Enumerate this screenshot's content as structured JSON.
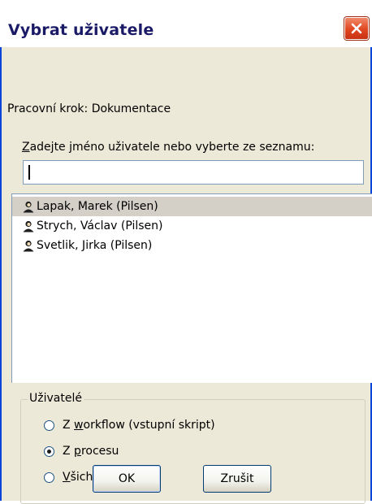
{
  "window": {
    "title": "Vybrat uživatele"
  },
  "dialog": {
    "step_label": "Pracovní krok: Dokumentace",
    "prompt_label": "Zadejte jméno uživatele nebo vyberte ze seznamu:",
    "prompt_accesskey": "Z",
    "prompt_rest": "adejte jméno uživatele nebo vyberte ze seznamu:",
    "user_input": {
      "value": ""
    }
  },
  "user_list": {
    "items": [
      {
        "label": "Lapak, Marek (Pilsen)",
        "selected": true,
        "icon": "user-icon"
      },
      {
        "label": "Strych, Václav (Pilsen)",
        "selected": false,
        "icon": "user-icon"
      },
      {
        "label": "Svetlik, Jirka (Pilsen)",
        "selected": false,
        "icon": "user-icon"
      }
    ]
  },
  "users_group": {
    "title": "Uživatelé",
    "options": [
      {
        "label": "Z workflow (vstupní skript)",
        "prefix": "Z ",
        "accesskey": "w",
        "rest": "orkflow (vstupní skript)",
        "checked": false
      },
      {
        "label": "Z procesu",
        "prefix": "Z ",
        "accesskey": "p",
        "rest": "rocesu",
        "checked": true
      },
      {
        "label": "Všichni uživatelé",
        "prefix": "",
        "accesskey": "V",
        "rest": "šichni uživatelé",
        "checked": false
      }
    ]
  },
  "buttons": {
    "ok": "OK",
    "cancel": "Zrušit"
  },
  "colors": {
    "title_text": "#1a1a66",
    "frame_blue": "#0a46d9",
    "close_red": "#e0461f",
    "dialog_bg": "#ece9d8"
  }
}
